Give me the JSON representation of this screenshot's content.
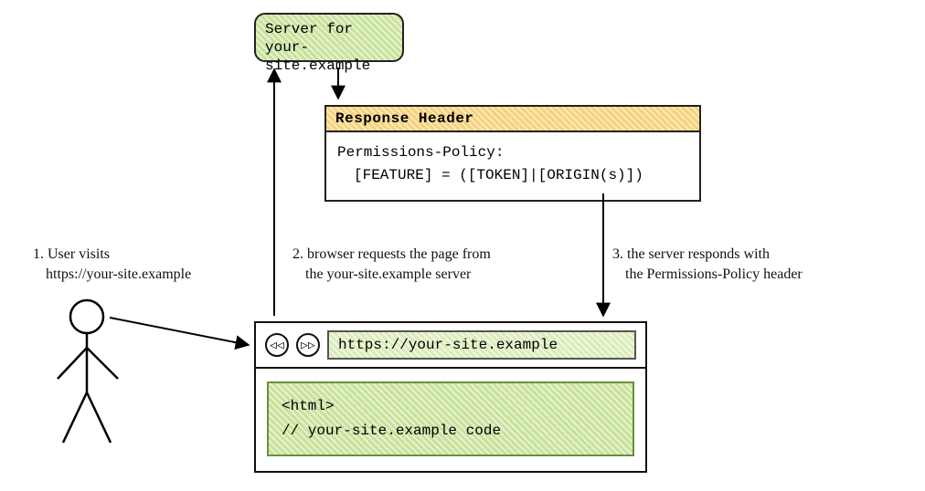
{
  "server": {
    "line1": "Server for",
    "line2": "your-site.example"
  },
  "response_header": {
    "title": "Response Header",
    "line1": "Permissions-Policy:",
    "line2": "[FEATURE] = ([TOKEN]|[ORIGIN(s)])"
  },
  "captions": {
    "step1_line1": "1. User visits",
    "step1_line2": "https://your-site.example",
    "step2_line1": "2. browser requests the page from",
    "step2_line2": "the your-site.example server",
    "step3_line1": "3. the server responds with",
    "step3_line2": "the Permissions-Policy header"
  },
  "browser": {
    "back_glyph": "◁◁",
    "forward_glyph": "▷▷",
    "address": "https://your-site.example",
    "code_line1": "<html>",
    "code_line2": "// your-site.example code"
  }
}
